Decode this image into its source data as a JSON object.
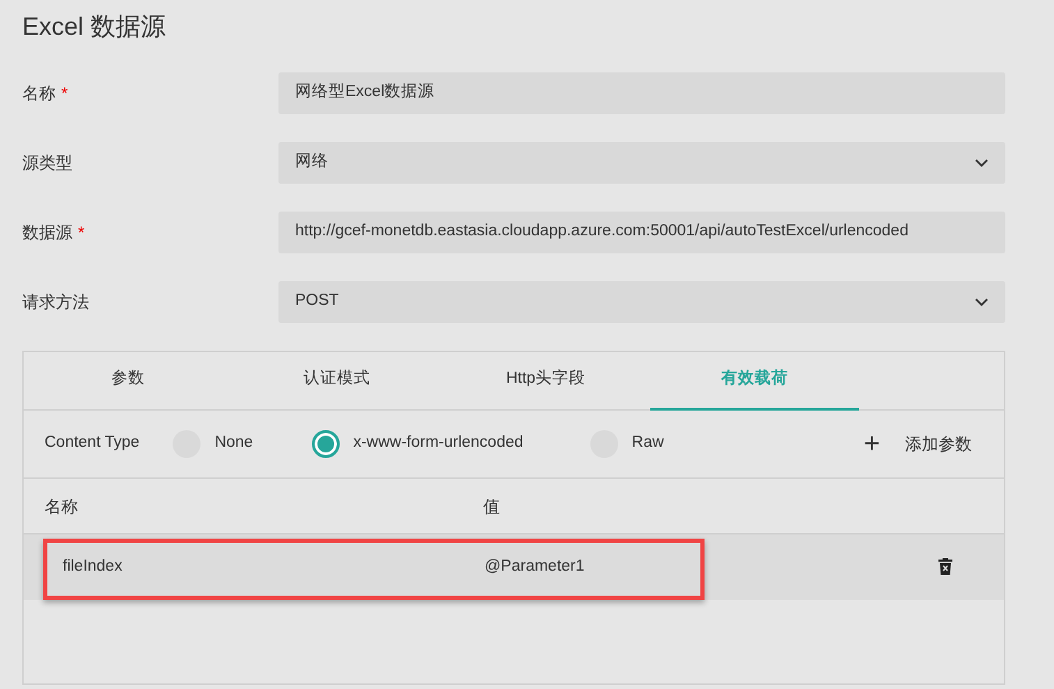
{
  "title": "Excel 数据源",
  "fields": [
    {
      "label": "名称",
      "required_mark": "*",
      "kind": "text",
      "value": "网络型Excel数据源"
    },
    {
      "label": "源类型",
      "kind": "select",
      "value": "网络"
    },
    {
      "label": "数据源",
      "required_mark": "*",
      "kind": "text",
      "value": "http://gcef-monetdb.eastasia.cloudapp.azure.com:50001/api/autoTestExcel/urlencoded"
    },
    {
      "label": "请求方法",
      "kind": "select",
      "value": "POST"
    }
  ],
  "tabs": [
    {
      "label": "参数",
      "selected": false
    },
    {
      "label": "认证模式",
      "selected": false
    },
    {
      "label": "Http头字段",
      "selected": false
    },
    {
      "label": "有效载荷",
      "selected": true
    }
  ],
  "content_type": {
    "label": "Content Type",
    "options": [
      {
        "label": "None",
        "selected": false
      },
      {
        "label": "x-www-form-urlencoded",
        "selected": true
      },
      {
        "label": "Raw",
        "selected": false
      }
    ],
    "add_button": {
      "icon": "+",
      "label": "添加参数"
    }
  },
  "table": {
    "columns": [
      "名称",
      "值"
    ],
    "rows": [
      {
        "name": "fileIndex",
        "value": "@Parameter1",
        "highlighted": true
      }
    ]
  }
}
